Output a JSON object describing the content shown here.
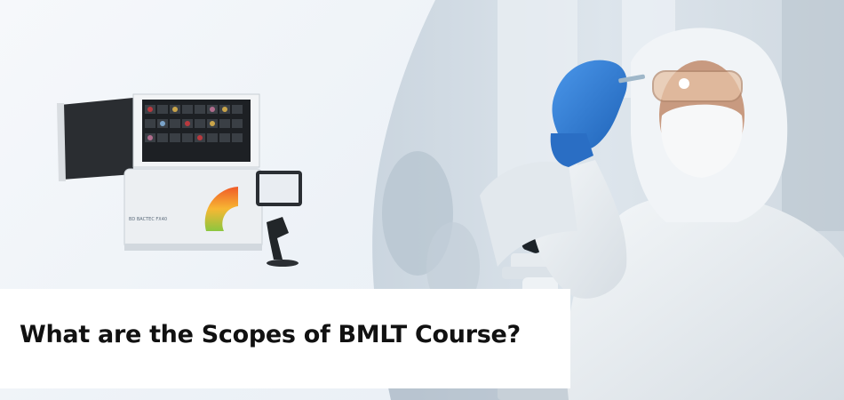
{
  "banner": {
    "heading": "What are the Scopes of BMLT Course?",
    "device_brand": "BD BACTEC FX40"
  },
  "colors": {
    "band_background": "#ffffff",
    "heading_text": "#111111",
    "glove_blue": "#2f7fd9",
    "suit_white": "#eef2f5"
  }
}
